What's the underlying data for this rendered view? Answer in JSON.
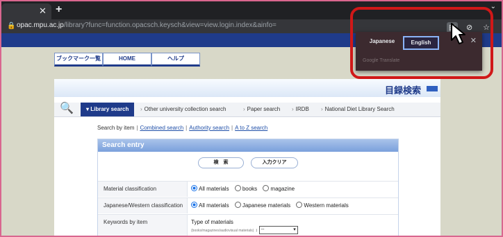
{
  "browser": {
    "tab_close": "✕",
    "new_tab": "+",
    "tab_menu": "⌄",
    "url_host": "opac.mpu.ac.jp",
    "url_path": "/library?func=function.opacsch.keysch&view=view.login.index&ainfo="
  },
  "translate_popup": {
    "languages": [
      "Japanese",
      "English"
    ],
    "selected": "English",
    "close": "✕",
    "footer": "Google Translate"
  },
  "site": {
    "nav_tabs": [
      "ブックマーク一覧",
      "HOME",
      "ヘルプ"
    ],
    "banner_title": "目録検索",
    "search_bar": [
      "Library search",
      "Other university collection search",
      "Paper search",
      "IRDB",
      "National Diet Library Search"
    ],
    "search_links": {
      "prefix": "Search by item",
      "links": [
        "Combined search",
        "Authority search",
        "A to Z search"
      ]
    },
    "panel": {
      "title": "Search entry",
      "search_button": "検　索",
      "clear_button": "入力クリア",
      "rows": [
        {
          "label": "Material classification",
          "options": [
            "All materials",
            "books",
            "magazine"
          ]
        },
        {
          "label": "Japanese/Western classification",
          "options": [
            "All materials",
            "Japanese materials",
            "Western materials"
          ]
        },
        {
          "label": "Keywords by item",
          "type_label": "Type of materials",
          "type_sub": "(books/magazines/audiovisual materials)",
          "select_value": "--"
        }
      ]
    }
  },
  "colors": {
    "highlight": "#d01818",
    "brand": "#1f3b8a",
    "chrome": "#202124"
  }
}
